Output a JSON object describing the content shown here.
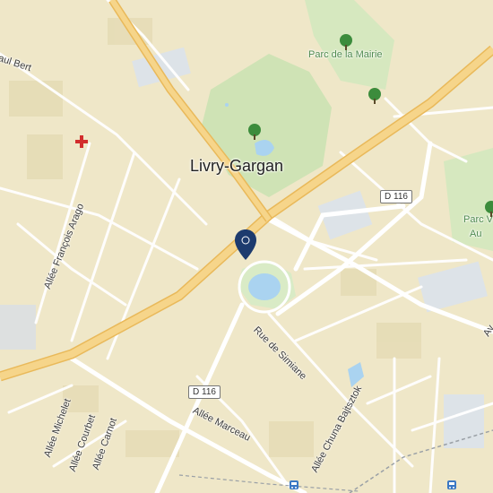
{
  "city": "Livry-Gargan",
  "parks": {
    "mairie": "Parc de la Mairie",
    "right_top": "Parc V",
    "right_bottom": "Au"
  },
  "streets": {
    "paul_bert": "aul Bert",
    "francois_arago": "Allée François Arago",
    "rue_simiane": "Rue de Simiane",
    "marceau": "Allée Marceau",
    "michelet": "Allée Michelet",
    "courbet": "Allée Courbet",
    "carnot": "Allée Carnot",
    "chuna": "Allée Chuna Bajtsztok",
    "right_edge": "Av"
  },
  "roads": {
    "d116_top": "D 116",
    "d116_bottom": "D 116"
  },
  "icons": {
    "pin": "location-pin-icon",
    "hospital": "red-cross-icon",
    "tree": "tree-icon",
    "train": "train-station-icon"
  },
  "colors": {
    "land": "#efe7c8",
    "park": "#cfe3b5",
    "water": "#aad3f0",
    "major_road": "#f6d58a",
    "pin": "#1d3b6e"
  }
}
